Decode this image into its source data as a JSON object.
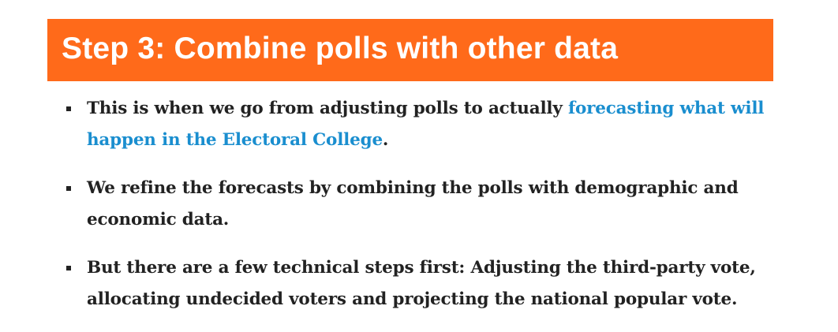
{
  "header": {
    "title": "Step 3: Combine polls with other data",
    "background_color": "#ff6a1a",
    "text_color": "#ffffff"
  },
  "bullets": [
    {
      "text_before": "This is when we go from adjusting polls to actually ",
      "link_text": "forecasting what will happen in the Electoral College",
      "text_after": "."
    },
    {
      "text": "We refine the forecasts by combining the polls with demographic and economic data."
    },
    {
      "text": "But there are a few technical steps first: Adjusting the third-party vote, allocating undecided voters and projecting the national popular vote."
    }
  ],
  "colors": {
    "body_text": "#222222",
    "link": "#1a8ecf"
  }
}
